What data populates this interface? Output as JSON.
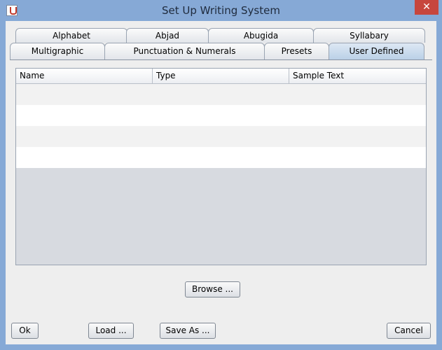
{
  "window": {
    "title": "Set Up Writing System",
    "close_glyph": "✕"
  },
  "tabs": {
    "row1": [
      "Alphabet",
      "Abjad",
      "Abugida",
      "Syllabary"
    ],
    "row2": [
      "Multigraphic",
      "Punctuation & Numerals",
      "Presets",
      "User Defined"
    ],
    "selected": "User Defined"
  },
  "table": {
    "columns": [
      "Name",
      "Type",
      "Sample Text"
    ],
    "rows": []
  },
  "buttons": {
    "browse": "Browse ...",
    "ok": "Ok",
    "load": "Load ...",
    "save_as": "Save As ...",
    "cancel": "Cancel"
  },
  "icons": {
    "app": "java-cup-icon",
    "close": "close-icon"
  }
}
